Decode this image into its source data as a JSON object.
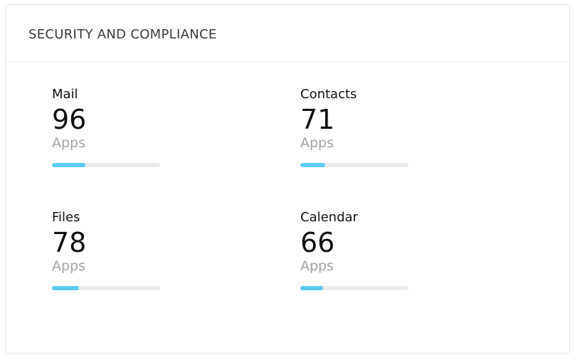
{
  "card": {
    "title": "SECURITY AND COMPLIANCE"
  },
  "colors": {
    "progress_fill": "#5ecbf0",
    "progress_track": "#ececec"
  },
  "stats": [
    {
      "label": "Mail",
      "value": "96",
      "unit": "Apps",
      "progress": 0.31
    },
    {
      "label": "Contacts",
      "value": "71",
      "unit": "Apps",
      "progress": 0.23
    },
    {
      "label": "Files",
      "value": "78",
      "unit": "Apps",
      "progress": 0.25
    },
    {
      "label": "Calendar",
      "value": "66",
      "unit": "Apps",
      "progress": 0.21
    }
  ]
}
